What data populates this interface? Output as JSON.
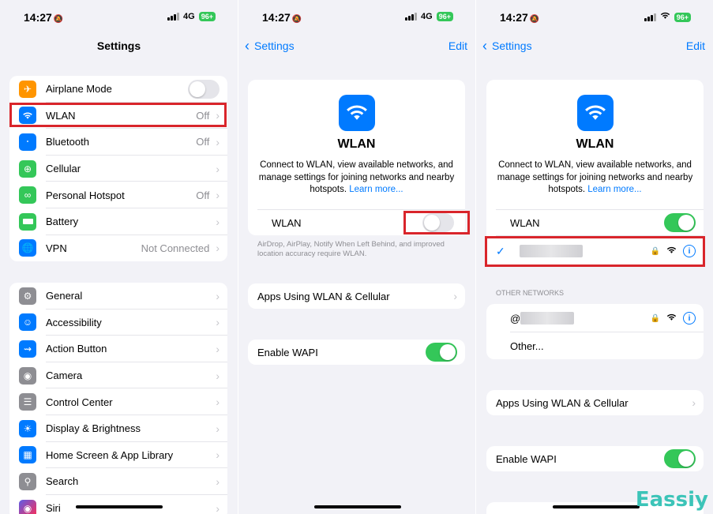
{
  "status": {
    "time": "14:27",
    "network": "4G",
    "battery": "96+"
  },
  "screen1": {
    "title": "Settings",
    "group1": [
      {
        "label": "Airplane Mode",
        "value": "",
        "icon": "airplane-icon",
        "color": "#ff9500"
      },
      {
        "label": "WLAN",
        "value": "Off",
        "icon": "wifi-icon",
        "color": "#007aff"
      },
      {
        "label": "Bluetooth",
        "value": "Off",
        "icon": "bluetooth-icon",
        "color": "#007aff"
      },
      {
        "label": "Cellular",
        "value": "",
        "icon": "antenna-icon",
        "color": "#34c759"
      },
      {
        "label": "Personal Hotspot",
        "value": "Off",
        "icon": "link-icon",
        "color": "#34c759"
      },
      {
        "label": "Battery",
        "value": "",
        "icon": "battery-icon",
        "color": "#34c759"
      },
      {
        "label": "VPN",
        "value": "Not Connected",
        "icon": "globe-icon",
        "color": "#007aff"
      }
    ],
    "group2": [
      {
        "label": "General",
        "icon": "gear-icon",
        "color": "#8e8e93"
      },
      {
        "label": "Accessibility",
        "icon": "accessibility-icon",
        "color": "#007aff"
      },
      {
        "label": "Action Button",
        "icon": "action-button-icon",
        "color": "#007aff"
      },
      {
        "label": "Camera",
        "icon": "camera-icon",
        "color": "#8e8e93"
      },
      {
        "label": "Control Center",
        "icon": "toggles-icon",
        "color": "#8e8e93"
      },
      {
        "label": "Display & Brightness",
        "icon": "sun-icon",
        "color": "#007aff"
      },
      {
        "label": "Home Screen & App Library",
        "icon": "phone-grid-icon",
        "color": "#007aff"
      },
      {
        "label": "Search",
        "icon": "search-icon",
        "color": "#8e8e93"
      },
      {
        "label": "Siri",
        "icon": "siri-icon",
        "color": "#5e5ce6"
      }
    ]
  },
  "wlan": {
    "back": "Settings",
    "edit": "Edit",
    "title": "WLAN",
    "description": "Connect to WLAN, view available networks, and manage settings for joining networks and nearby hotspots.",
    "learn_more": "Learn more...",
    "toggle_label": "WLAN",
    "footnote": "AirDrop, AirPlay, Notify When Left Behind, and improved location accuracy require WLAN.",
    "apps_label": "Apps Using WLAN & Cellular",
    "wapi_label": "Enable WAPI",
    "other_header": "OTHER NETWORKS",
    "other_label": "Other...",
    "network_prefix": "@"
  },
  "watermark": "Eassiy",
  "accent": "#007aff",
  "highlight": "#d9252b"
}
